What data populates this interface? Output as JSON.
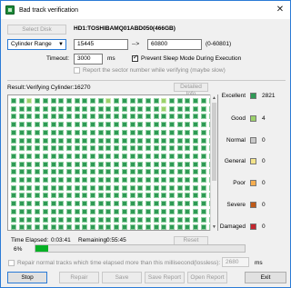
{
  "window": {
    "title": "Bad track verification",
    "close": "✕"
  },
  "top": {
    "select_disk": "Select Disk",
    "disk_name": "HD1:TOSHIBAMQ01ABD050(466GB)",
    "range_mode": "Cylinder Range",
    "from": "15445",
    "arrow": "-->",
    "to": "60800",
    "range_hint": "(0-60801)",
    "timeout_label": "Timeout:",
    "timeout_value": "3000",
    "timeout_unit": "ms",
    "prevent_sleep": "Prevent Sleep Mode During Execution",
    "report_sector": "Report the sector number while verifying (maybe slow)"
  },
  "result": {
    "label": "Result:",
    "status": "Verifying Cylinder:16270",
    "detailed_info": "Detailed Info"
  },
  "grid": {
    "rows": 17,
    "cols": 26,
    "good_cells": [
      2,
      12,
      19,
      45
    ]
  },
  "legend": [
    {
      "name": "Excellent",
      "count": "2821",
      "color": "#2e9a55"
    },
    {
      "name": "Good",
      "count": "4",
      "color": "#9bd16a"
    },
    {
      "name": "Normal",
      "count": "0",
      "color": "#c8c8c8"
    },
    {
      "name": "General",
      "count": "0",
      "color": "#f3e38a"
    },
    {
      "name": "Poor",
      "count": "0",
      "color": "#f6ad4f"
    },
    {
      "name": "Severe",
      "count": "0",
      "color": "#c05a18"
    },
    {
      "name": "Damaged",
      "count": "0",
      "color": "#c4262e"
    }
  ],
  "time": {
    "elapsed_label": "Time Elapsed:",
    "elapsed": "0:03:41",
    "remaining_label": "Remaining:",
    "remaining": "0:55:45",
    "reset": "Reset"
  },
  "progress": {
    "text": "6%",
    "value": 0.06
  },
  "repair_option": {
    "label": "Repair normal tracks which time elapsed more than this millisecond(lossless):",
    "value": "2680",
    "unit": "ms"
  },
  "buttons": {
    "stop": "Stop",
    "repair": "Repair",
    "save": "Save",
    "save_report": "Save Report",
    "open_report": "Open Report",
    "exit": "Exit"
  }
}
